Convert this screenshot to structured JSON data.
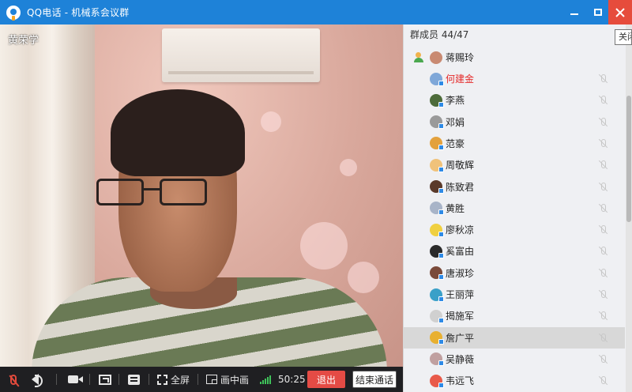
{
  "window": {
    "title": "QQ电话 - 机械系会议群",
    "tooltip": "关闭"
  },
  "video": {
    "participant_name": "黄荣学"
  },
  "toolbar": {
    "fullscreen_label": "全屏",
    "pip_label": "画中画",
    "duration": "50:25",
    "exit_label": "退出",
    "end_call_label": "结束通话"
  },
  "members": {
    "header": "群成员 44/47",
    "host": "蒋赐玲",
    "list": [
      {
        "name": "何建金",
        "avatar_color": "#7fa7d8",
        "highlight": true
      },
      {
        "name": "李燕",
        "avatar_color": "#4d6b3a"
      },
      {
        "name": "邓娟",
        "avatar_color": "#9a9a9a"
      },
      {
        "name": "范豪",
        "avatar_color": "#e3a13d"
      },
      {
        "name": "周敬辉",
        "avatar_color": "#f0c27a"
      },
      {
        "name": "陈致君",
        "avatar_color": "#5a3a2a"
      },
      {
        "name": "黄胜",
        "avatar_color": "#a8b4c8"
      },
      {
        "name": "廖秋凉",
        "avatar_color": "#f0d040"
      },
      {
        "name": "奚富由",
        "avatar_color": "#2a2a2a"
      },
      {
        "name": "唐淑珍",
        "avatar_color": "#7a4a3a"
      },
      {
        "name": "王丽萍",
        "avatar_color": "#3aa0c8"
      },
      {
        "name": "揭施军",
        "avatar_color": "#d0d0d0"
      },
      {
        "name": "詹广平",
        "avatar_color": "#e8b030"
      },
      {
        "name": "吴静薇",
        "avatar_color": "#c0a0a0"
      },
      {
        "name": "韦远飞",
        "avatar_color": "#e85a4a"
      }
    ]
  }
}
